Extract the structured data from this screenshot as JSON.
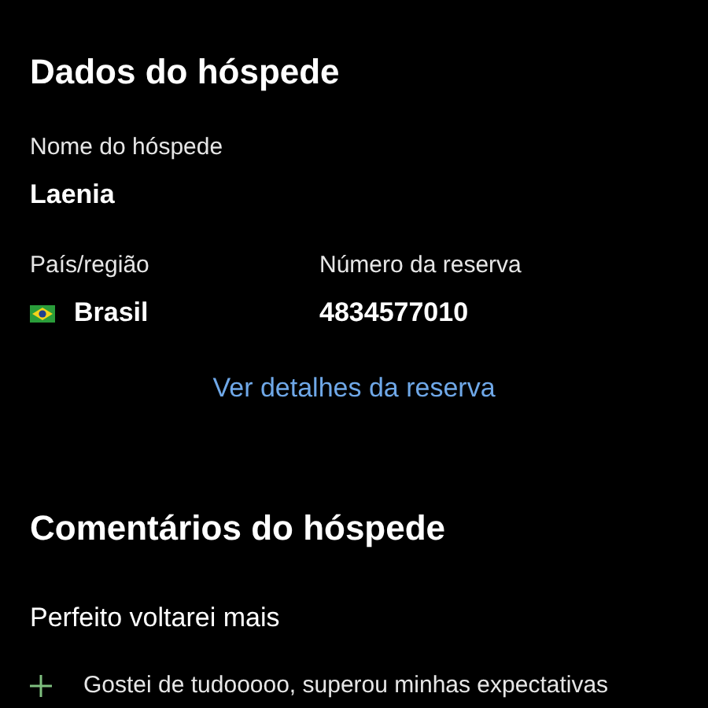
{
  "guest_section": {
    "title": "Dados do hóspede",
    "name_label": "Nome do hóspede",
    "name": "Laenia",
    "country_label": "País/região",
    "country": "Brasil",
    "reservation_label": "Número da reserva",
    "reservation_number": "4834577010",
    "details_link": "Ver detalhes da reserva"
  },
  "comments_section": {
    "title": "Comentários do hóspede",
    "headline": "Perfeito voltarei mais",
    "positive": "Gostei de tudooooo, superou minhas expectativas"
  }
}
